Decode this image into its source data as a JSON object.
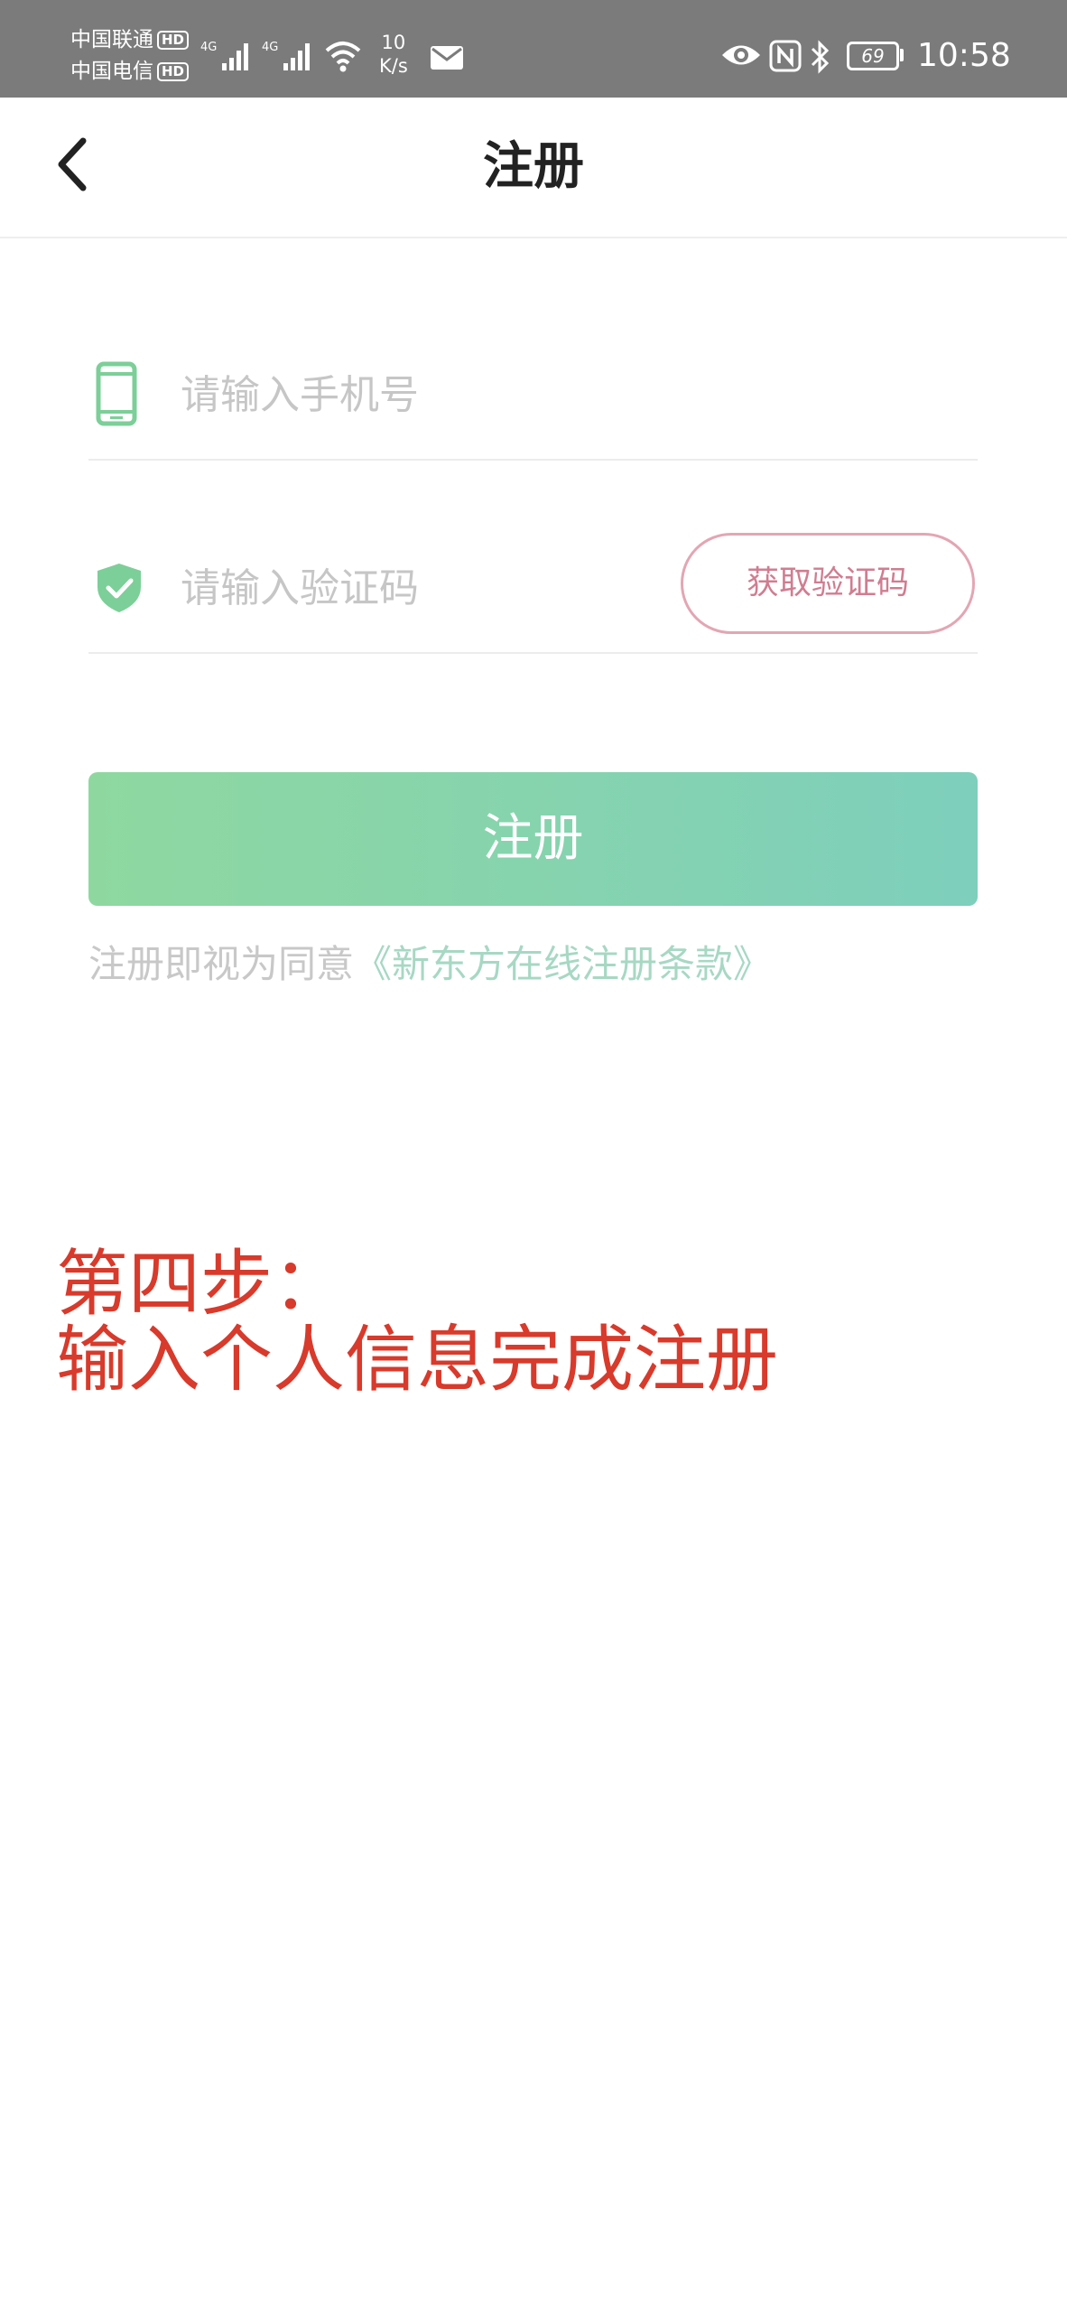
{
  "status_bar": {
    "carrier_1": "中国联通",
    "carrier_2": "中国电信",
    "hd_badge": "HD",
    "network_1": "4G",
    "network_2": "4G",
    "speed_value": "10",
    "speed_unit": "K/s",
    "battery": "69",
    "time": "10:58",
    "icons": [
      "signal-icon",
      "wifi-icon",
      "mail-icon",
      "eye-icon",
      "nfc-icon",
      "bluetooth-icon",
      "battery-icon"
    ]
  },
  "nav": {
    "back_icon": "chevron-left-icon",
    "title": "注册"
  },
  "form": {
    "phone": {
      "icon": "phone-icon",
      "placeholder": "请输入手机号",
      "value": ""
    },
    "code": {
      "icon": "shield-check-icon",
      "placeholder": "请输入验证码",
      "value": "",
      "get_code_label": "获取验证码"
    },
    "submit_label": "注册",
    "terms_prefix": "注册即视为同意",
    "terms_link": "《新东方在线注册条款》"
  },
  "annotation": {
    "line1": "第四步：",
    "line2": "输入个人信息完成注册"
  },
  "colors": {
    "status_bar_bg": "#7b7b7b",
    "primary_gradient_start": "#8ed8a0",
    "primary_gradient_end": "#7ecfbc",
    "code_button_border": "#e3a6b3",
    "annotation": "#d83a2b"
  }
}
